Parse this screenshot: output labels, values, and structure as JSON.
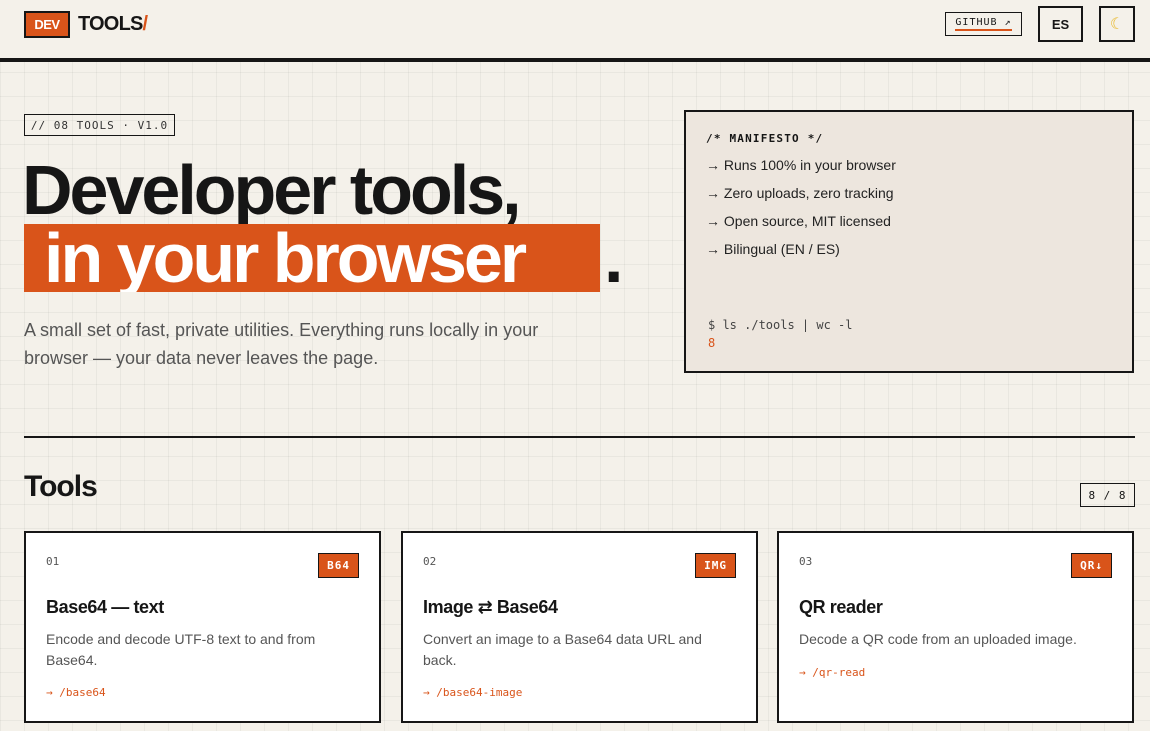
{
  "header": {
    "logo_dev": "DEV",
    "logo_tools": "TOOLS",
    "logo_slash": "/",
    "github_label": "GITHUB ↗",
    "lang_label": "ES",
    "theme_icon": "☾"
  },
  "hero": {
    "badge": "// 08 TOOLS · V1.0",
    "title_line1": "Developer tools,",
    "title_line2": "in your browser",
    "title_dot": ".",
    "lead": "A small set of fast, private utilities. Everything runs locally in your browser — your data never leaves the page."
  },
  "manifesto": {
    "title": "/* MANIFESTO */",
    "items": [
      "→ Runs 100% in your browser",
      "→ Zero uploads, zero tracking",
      "→ Open source, MIT licensed",
      "→ Bilingual (EN / ES)"
    ],
    "command": "$ ls ./tools | wc -l",
    "output": "8"
  },
  "tools": {
    "title": "Tools",
    "count": "8 / 8",
    "cards": [
      {
        "num": "01",
        "tag": "B64",
        "title": "Base64 — text",
        "desc": "Encode and decode UTF-8 text to and from Base64.",
        "link": "→ /base64"
      },
      {
        "num": "02",
        "tag": "IMG",
        "title": "Image ⇄ Base64",
        "desc": "Convert an image to a Base64 data URL and back.",
        "link": "→ /base64-image"
      },
      {
        "num": "03",
        "tag": "QR↓",
        "title": "QR reader",
        "desc": "Decode a QR code from an uploaded image.",
        "link": "→ /qr-read"
      }
    ]
  },
  "colors": {
    "accent": "#d9541a",
    "ink": "#161616",
    "background": "#f4f1ea",
    "panel": "#ede6de"
  }
}
